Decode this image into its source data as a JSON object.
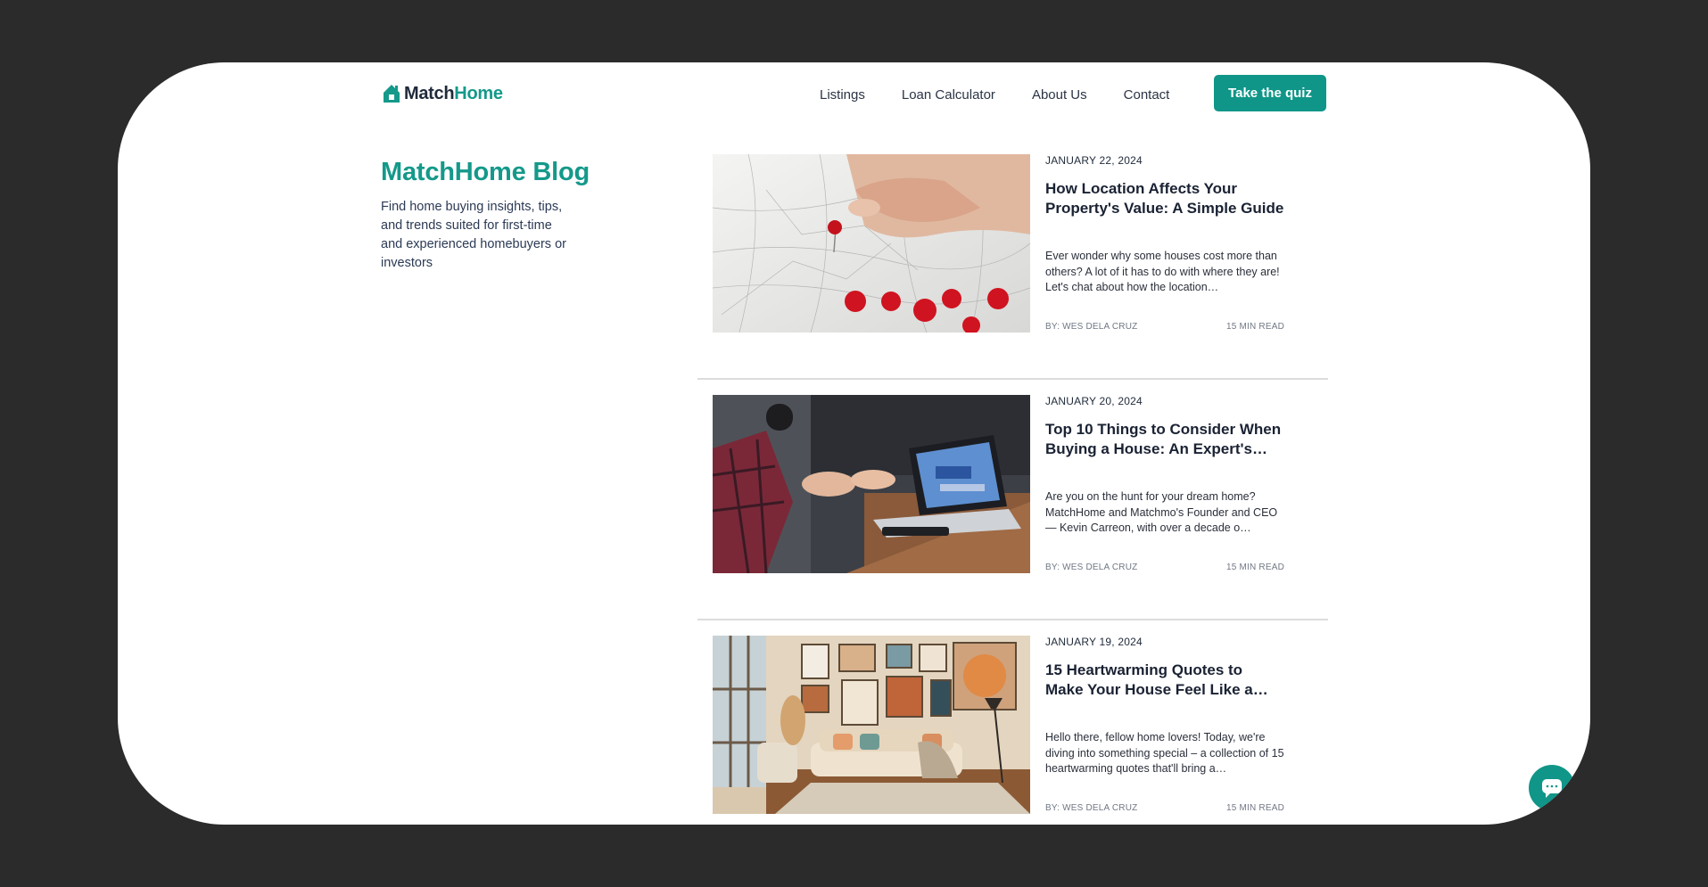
{
  "brand": {
    "name_part1": "Match",
    "name_part2": "Home",
    "color": "#14998a"
  },
  "nav": {
    "items": [
      {
        "label": "Listings"
      },
      {
        "label": "Loan Calculator"
      },
      {
        "label": "About Us"
      },
      {
        "label": "Contact"
      }
    ],
    "cta_label": "Take the quiz",
    "cta_color": "#0f9688"
  },
  "sidebar": {
    "title": "MatchHome Blog",
    "description": "Find home buying insights, tips, and trends suited for first-time and experienced homebuyers or investors"
  },
  "posts": [
    {
      "date": "JANUARY 22, 2024",
      "title": "How Location Affects Your Property's Value: A Simple Guide",
      "excerpt": "Ever wonder why some houses cost more than others? A lot of it has to do with where they are! Let's chat about how the location…",
      "author": "BY: WES DELA CRUZ",
      "read_time": "15 MIN READ",
      "image": "map-with-red-pins"
    },
    {
      "date": "JANUARY 20, 2024",
      "title": "Top 10 Things to Consider When Buying a House: An Expert's…",
      "excerpt": "Are you on the hunt for your dream home? MatchHome and Matchmo's Founder and CEO — Kevin Carreon, with over a decade o…",
      "author": "BY: WES DELA CRUZ",
      "read_time": "15 MIN READ",
      "image": "people-talking-at-laptop"
    },
    {
      "date": "JANUARY 19, 2024",
      "title": "15 Heartwarming Quotes to Make Your House Feel Like a…",
      "excerpt": "Hello there, fellow home lovers! Today, we're diving into something special – a collection of 15 heartwarming quotes that'll bring a…",
      "author": "BY: WES DELA CRUZ",
      "read_time": "15 MIN READ",
      "image": "cozy-living-room"
    }
  ],
  "chat": {
    "icon": "chat-bubble-icon"
  }
}
